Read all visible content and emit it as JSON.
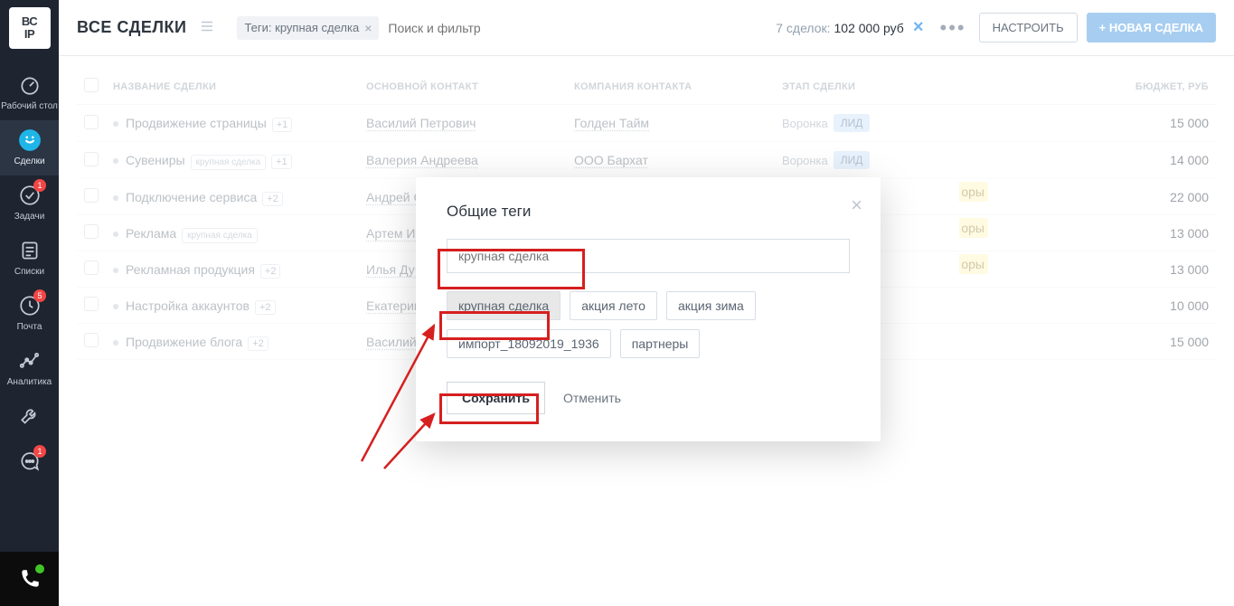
{
  "logo": "ВС\nIP",
  "sidebar": {
    "items": [
      {
        "label": "Рабочий стол"
      },
      {
        "label": "Сделки"
      },
      {
        "label": "Задачи",
        "badge": "1"
      },
      {
        "label": "Списки"
      },
      {
        "label": "Почта",
        "badge": "5"
      },
      {
        "label": "Аналитика"
      },
      {
        "label": ""
      },
      {
        "label": "",
        "badge": "1"
      }
    ]
  },
  "topbar": {
    "title": "ВСЕ СДЕЛКИ",
    "chip_label": "Теги: крупная сделка",
    "search_placeholder": "Поиск и фильтр",
    "count_prefix": "7 сделок:",
    "count_value": "102 000 руб",
    "configure": "НАСТРОИТЬ",
    "new_deal": "+ НОВАЯ СДЕЛКА"
  },
  "table": {
    "headers": [
      "",
      "НАЗВАНИЕ СДЕЛКИ",
      "ОСНОВНОЙ КОНТАКТ",
      "КОМПАНИЯ КОНТАКТА",
      "ЭТАП СДЕЛКИ",
      "БЮДЖЕТ, РУБ"
    ],
    "rows": [
      {
        "name": "Продвижение страницы",
        "tag": "",
        "plus": "+1",
        "contact": "Василий Петрович",
        "company": "Голден Тайм",
        "funnel": "Воронка",
        "stage": "ЛИД",
        "stage_cls": "st-blue",
        "budget": "15 000"
      },
      {
        "name": "Сувениры",
        "tag": "крупная сделка",
        "plus": "+1",
        "contact": "Валерия Андреева",
        "company": "ООО Бархат",
        "funnel": "Воронка",
        "stage": "ЛИД",
        "stage_cls": "st-blue",
        "budget": "14 000"
      },
      {
        "name": "Подключение сервиса",
        "tag": "",
        "plus": "+2",
        "contact": "Андрей Слот",
        "company": "",
        "funnel": "",
        "stage": "оры",
        "stage_cls": "peek",
        "budget": "22 000"
      },
      {
        "name": "Реклама",
        "tag": "крупная сделка",
        "plus": "",
        "contact": "Артем Ивано",
        "company": "",
        "funnel": "",
        "stage": "оры",
        "stage_cls": "peek",
        "budget": "13 000"
      },
      {
        "name": "Рекламная продукция",
        "tag": "",
        "plus": "+2",
        "contact": "Илья Дубин",
        "company": "",
        "funnel": "",
        "stage": "оры",
        "stage_cls": "peek",
        "budget": "13 000"
      },
      {
        "name": "Настройка аккаунтов",
        "tag": "",
        "plus": "+2",
        "contact": "Екатерина А",
        "company": "",
        "funnel": "",
        "stage": "",
        "stage_cls": "",
        "budget": "10 000"
      },
      {
        "name": "Продвижение блога",
        "tag": "",
        "plus": "+2",
        "contact": "Василий Пет",
        "company": "",
        "funnel": "",
        "stage": "",
        "stage_cls": "",
        "budget": "15 000"
      }
    ]
  },
  "modal": {
    "title": "Общие теги",
    "input_placeholder": "крупная сделка",
    "tags": [
      {
        "label": "крупная сделка",
        "selected": true
      },
      {
        "label": "акция лето",
        "selected": false
      },
      {
        "label": "акция зима",
        "selected": false
      },
      {
        "label": "импорт_18092019_1936",
        "selected": false
      },
      {
        "label": "партнеры",
        "selected": false
      }
    ],
    "save": "Сохранить",
    "cancel": "Отменить"
  }
}
